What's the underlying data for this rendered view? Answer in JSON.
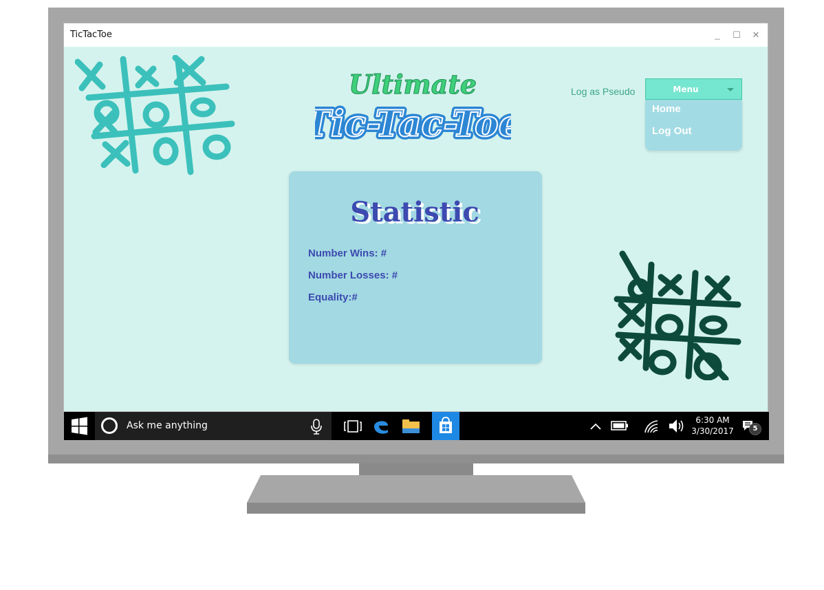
{
  "window": {
    "title": "TicTacToe",
    "controls": {
      "minimize": "_",
      "maximize": "☐",
      "close": "✕"
    }
  },
  "logo": {
    "line1": "Ultimate",
    "line2": "Tic-Tac-Toe"
  },
  "header": {
    "login_link": "Log as Pseudo",
    "menu_label": "Menu",
    "menu_items": [
      {
        "label": "Home"
      },
      {
        "label": "Log Out"
      }
    ]
  },
  "stats": {
    "title": "Statistic",
    "wins": "Number Wins: #",
    "losses": "Number Losses: #",
    "equality": "Equality:#"
  },
  "taskbar": {
    "search_placeholder": "Ask me anything",
    "time": "6:30 AM",
    "date": "3/30/2017",
    "notification_count": "5"
  },
  "colors": {
    "background": "#d5f3ee",
    "accent_green": "#3aa686",
    "menu_button": "#75e6cf",
    "card": "#a2d9e2",
    "stat_text": "#3d4ab0",
    "doodle_light": "#3cc0bb",
    "doodle_dark": "#0d4a3c",
    "logo_blue": "#2c86d4",
    "logo_green": "#3ecf7a"
  },
  "icons": {
    "start": "windows-logo-icon",
    "cortana": "cortana-circle-icon",
    "mic": "microphone-icon",
    "taskview": "task-view-icon",
    "edge": "edge-browser-icon",
    "explorer": "file-explorer-icon",
    "store": "store-icon",
    "chevron": "chevron-up-icon",
    "battery": "battery-icon",
    "wifi": "wifi-icon",
    "volume": "volume-icon",
    "notification": "action-center-icon"
  }
}
